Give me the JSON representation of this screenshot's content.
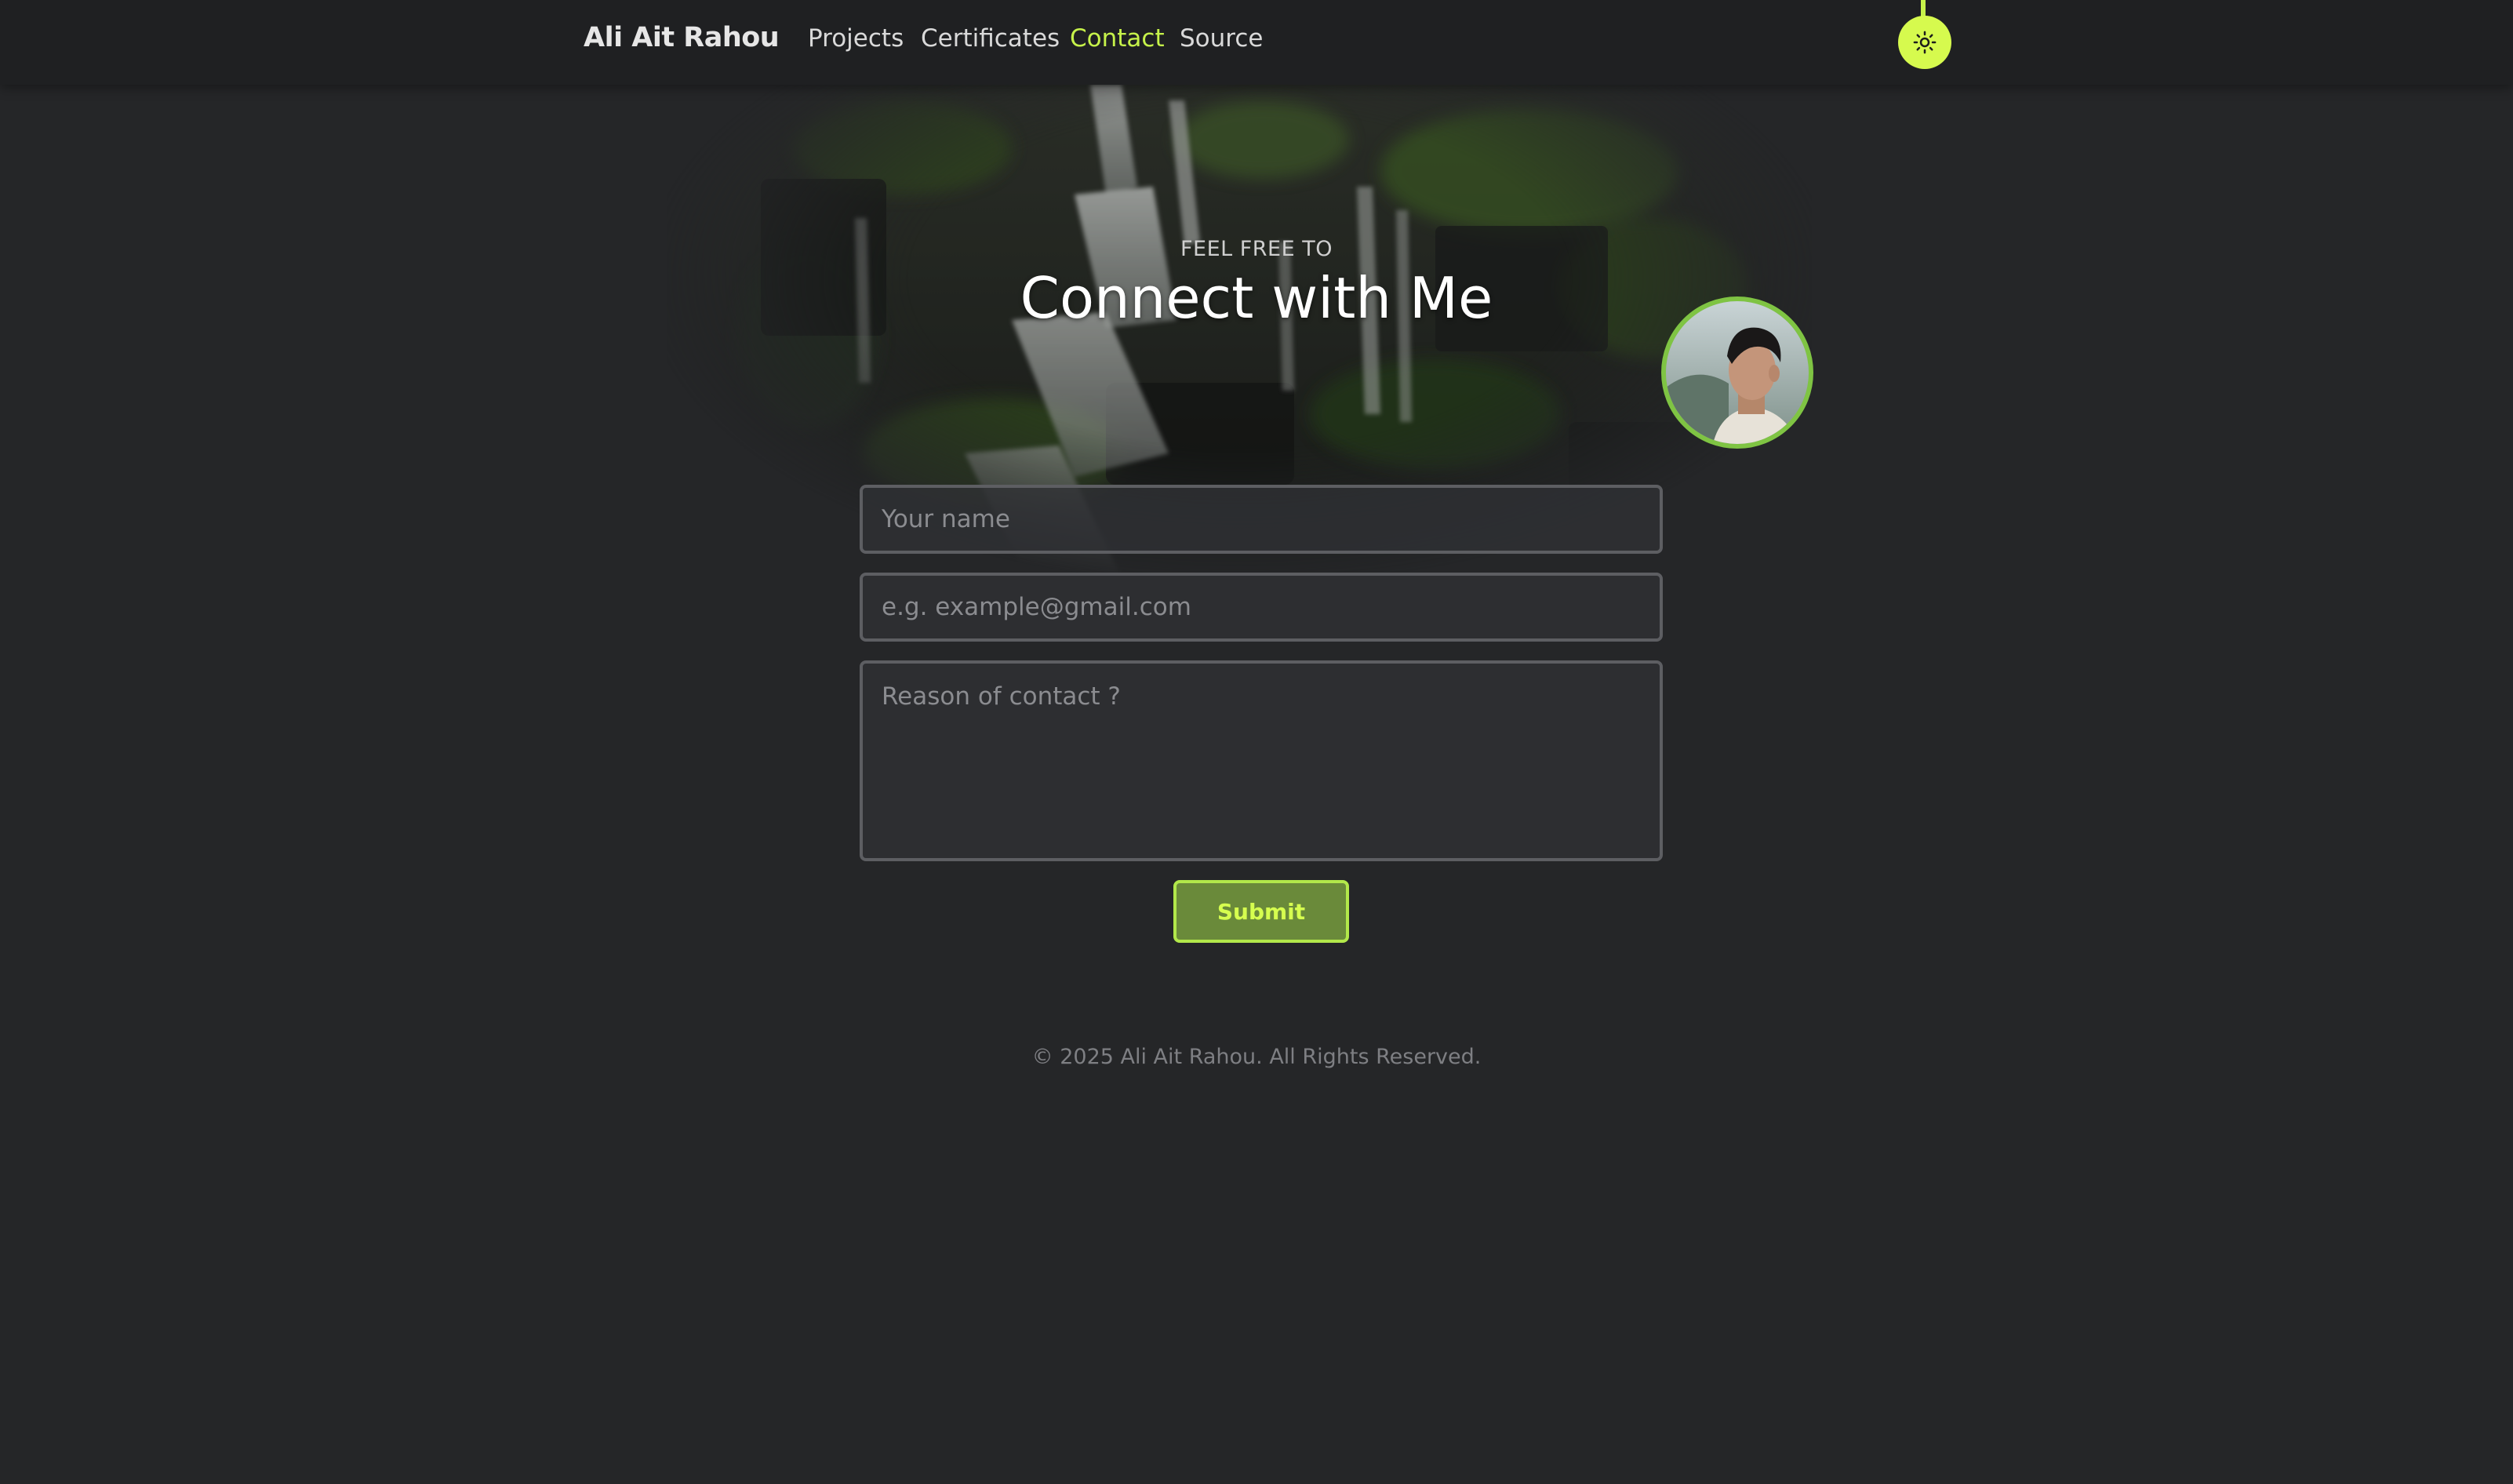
{
  "navbar": {
    "brand": "Ali Ait Rahou",
    "links": [
      "Projects",
      "Certificates",
      "Contact",
      "Source"
    ],
    "active_link": "Contact",
    "theme_toggle_icon": "sun-icon"
  },
  "hero": {
    "eyebrow": "FEEL FREE TO",
    "title": "Connect with Me",
    "background": "waterfall-forest-photo",
    "avatar": "profile-photo"
  },
  "form": {
    "name_placeholder": "Your name",
    "email_placeholder": "e.g. example@gmail.com",
    "message_placeholder": "Reason of contact ?",
    "name_value": "",
    "email_value": "",
    "message_value": "",
    "submit_label": "Submit"
  },
  "footer": {
    "copyright": "© 2025 Ali Ait Rahou. All Rights Reserved."
  },
  "colors": {
    "background": "#252628",
    "navbar": "#1f2022",
    "accent": "#c6f24a",
    "button_fill": "#6a8a3a",
    "avatar_ring": "#7fc443"
  }
}
